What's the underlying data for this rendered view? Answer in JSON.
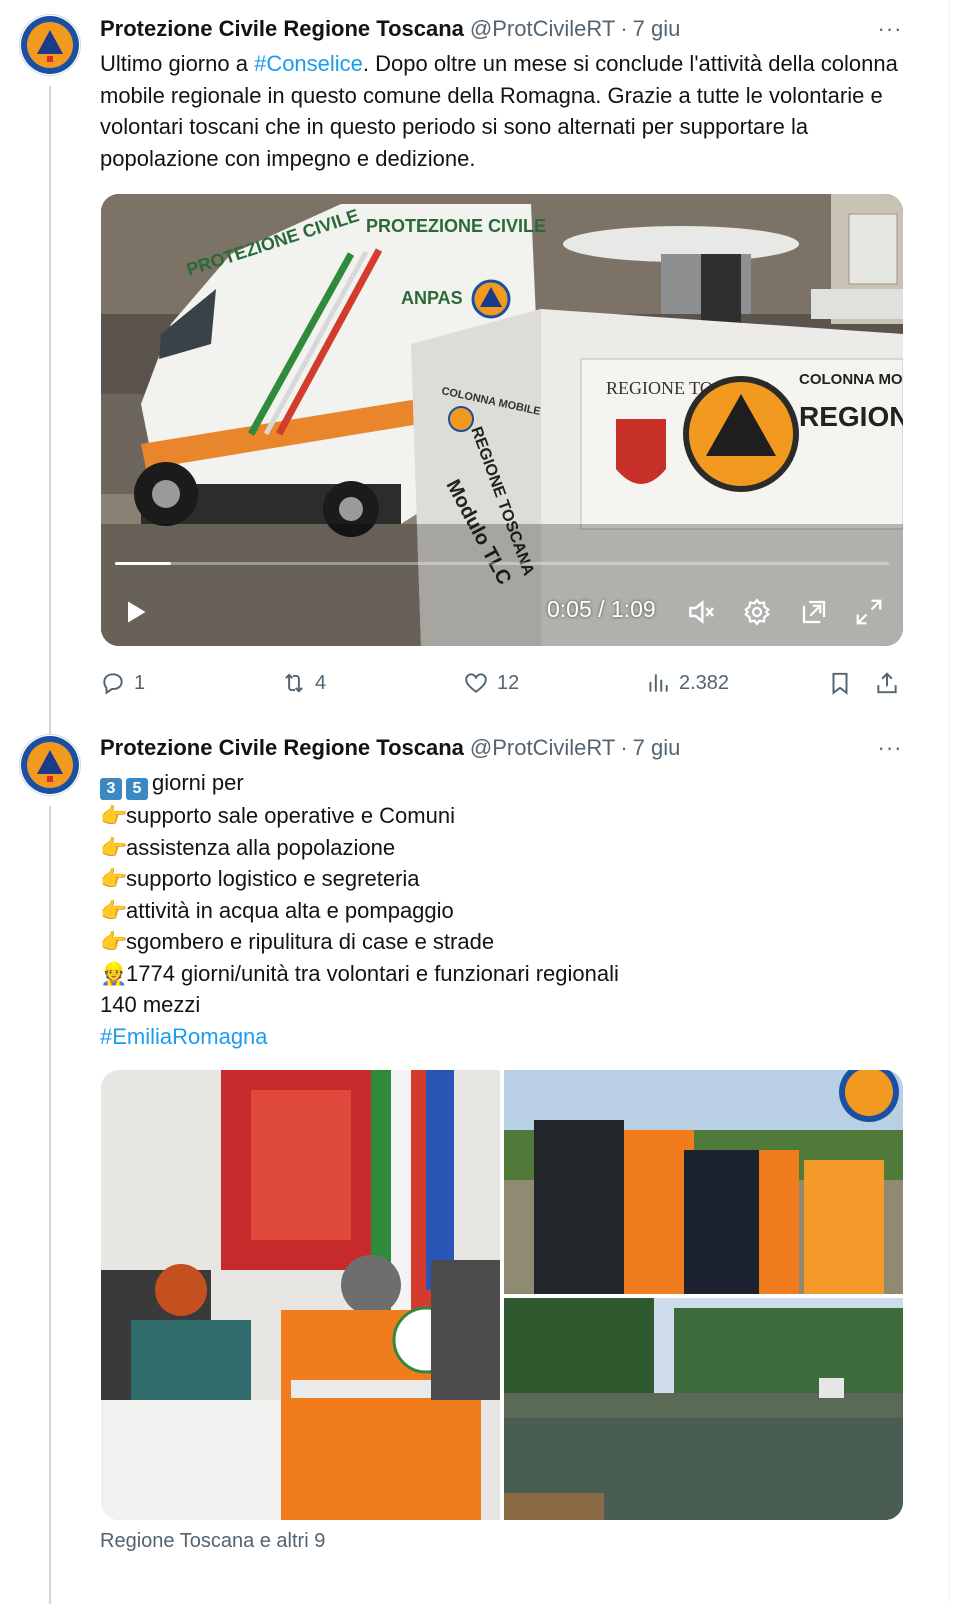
{
  "tweets": [
    {
      "author": "Protezione Civile Regione Toscana",
      "handle": "@ProtCivileRT",
      "separator": "·",
      "time": "7 giu",
      "more": "···",
      "text_before": "Ultimo giorno a ",
      "hashtag": "#Conselice",
      "text_after": ". Dopo oltre un mese si conclude l'attività della colonna mobile regionale in questo comune della Romagna. Grazie a tutte le volontarie e volontari toscani che in questo periodo si sono alternati per supportare la popolazione con impegno e dedizione.",
      "video": {
        "time_display": "0:05 / 1:09",
        "progress": 0.072,
        "van_label": "PROTEZIONE CIVILE",
        "van_brand": "ANPAS",
        "module_label_top": "COLONNA MOBILE",
        "module_label_region": "REGIONE TOSCANA",
        "module_label": "Modulo TLC",
        "panel_region": "REGIONE TOSCANA",
        "panel_colonna": "COLONNA MOBILE",
        "panel_regione": "REGIONE TOSCANA"
      },
      "stats": {
        "replies": "1",
        "retweets": "4",
        "likes": "12",
        "views": "2.382"
      }
    },
    {
      "author": "Protezione Civile Regione Toscana",
      "handle": "@ProtCivileRT",
      "separator": "·",
      "time": "7 giu",
      "more": "···",
      "lines": [
        "giorni per",
        "supporto sale operative e Comuni",
        "assistenza alla popolazione",
        "supporto logistico e segreteria",
        "attività in acqua alta e pompaggio",
        "sgombero e ripulitura di case e strade",
        "1774 giorni/unità tra volontari e funzionari regionali",
        "140 mezzi"
      ],
      "keycaps": [
        "3",
        "5"
      ],
      "hashtag": "#EmiliaRomagna",
      "tagged": "Regione Toscana e altri 9"
    }
  ],
  "colors": {
    "link": "#1d9bf0",
    "muted": "#536471",
    "text": "#0f1419"
  },
  "icons": [
    "reply-icon",
    "retweet-icon",
    "like-icon",
    "views-icon",
    "bookmark-icon",
    "share-icon",
    "play-icon",
    "mute-icon",
    "settings-icon",
    "pip-icon",
    "fullscreen-icon"
  ]
}
